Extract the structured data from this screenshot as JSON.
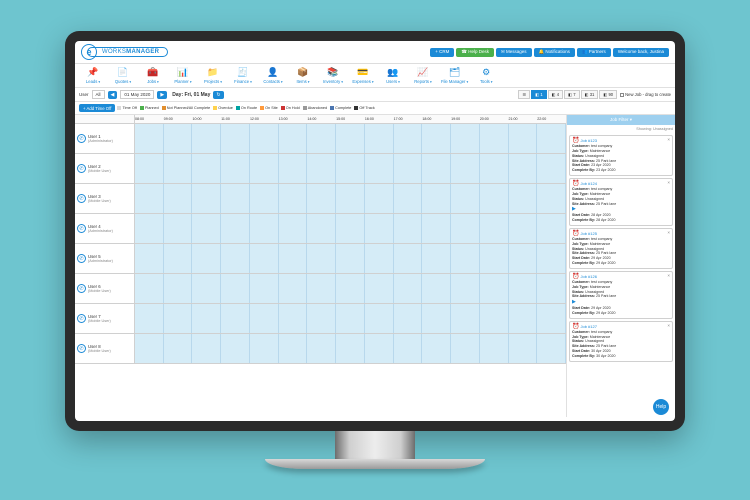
{
  "brand": {
    "icon_letter": "e",
    "name_a": "WORKS",
    "name_b": "MANAGER"
  },
  "top_pills": [
    {
      "label": "+ CRM"
    },
    {
      "label": "☎ Help Desk",
      "alt": true
    },
    {
      "label": "✉ Messages"
    },
    {
      "label": "🔔 Notifications"
    },
    {
      "label": "👥 Partners"
    },
    {
      "label": "Welcome back, Justina"
    }
  ],
  "nav": [
    {
      "icon": "📌",
      "label": "Leads"
    },
    {
      "icon": "📄",
      "label": "Quotes"
    },
    {
      "icon": "🧰",
      "label": "Jobs"
    },
    {
      "icon": "📊",
      "label": "Planner"
    },
    {
      "icon": "📁",
      "label": "Projects"
    },
    {
      "icon": "🧾",
      "label": "Finance"
    },
    {
      "icon": "👤",
      "label": "Contacts"
    },
    {
      "icon": "📦",
      "label": "Items"
    },
    {
      "icon": "📚",
      "label": "Inventory"
    },
    {
      "icon": "💳",
      "label": "Expenses"
    },
    {
      "icon": "👥",
      "label": "Users"
    },
    {
      "icon": "📈",
      "label": "Reports"
    },
    {
      "icon": "🗂",
      "label": "File Manager"
    },
    {
      "icon": "⚙",
      "label": "Tools"
    }
  ],
  "toolbar": {
    "user_label": "User",
    "all_option": "All",
    "prev": "◀",
    "date": "01 May 2020",
    "next": "▶",
    "day_title": "Day: Fri, 01 May",
    "refresh": "↻",
    "views": [
      {
        "label": "☰",
        "active": false
      },
      {
        "label": "◧ 1",
        "active": true
      },
      {
        "label": "◧ 4",
        "active": false
      },
      {
        "label": "◧ 7",
        "active": false
      },
      {
        "label": "◧ 31",
        "active": false
      },
      {
        "label": "◧ 90",
        "active": false
      }
    ],
    "new_job_check": "New Job - drag to create"
  },
  "subbar": {
    "add_time_off": "+ Add Time Off",
    "legend": [
      {
        "color": "#d9d9d9",
        "label": "Time Off"
      },
      {
        "color": "#4bb04b",
        "label": "Planned"
      },
      {
        "color": "#e28f2e",
        "label": "Not Planned/All Complete"
      },
      {
        "color": "#ffd24c",
        "label": "Overdue"
      },
      {
        "color": "#00a3a3",
        "label": "On Route"
      },
      {
        "color": "#ff9a3c",
        "label": "On Site"
      },
      {
        "color": "#cc3333",
        "label": "On Hold"
      },
      {
        "color": "#999999",
        "label": "Abandoned"
      },
      {
        "color": "#4b75b0",
        "label": "Complete"
      },
      {
        "color": "#333333",
        "label": "Off Track"
      }
    ]
  },
  "hours": [
    "08:00",
    "09:00",
    "10:00",
    "11:00",
    "12:00",
    "13:00",
    "14:00",
    "15:00",
    "16:00",
    "17:00",
    "18:00",
    "19:00",
    "20:00",
    "21:00",
    "22:00"
  ],
  "users": [
    {
      "name": "User 1",
      "role": "(Administrator)"
    },
    {
      "name": "User 2",
      "role": "(Mobile User)"
    },
    {
      "name": "User 3",
      "role": "(Mobile User)"
    },
    {
      "name": "User 4",
      "role": "(Administrator)"
    },
    {
      "name": "User 5",
      "role": "(Administrator)"
    },
    {
      "name": "User 6",
      "role": "(Mobile User)"
    },
    {
      "name": "User 7",
      "role": "(Mobile User)"
    },
    {
      "name": "User 8",
      "role": "(Mobile User)"
    }
  ],
  "side": {
    "filter_label": "Job Filter ▾",
    "showing": "Showing: Unassigned",
    "jobs": [
      {
        "ref": "Job #123",
        "customer": "test company",
        "jobtype": "Maintenance",
        "status": "Unassigned",
        "site": "25 Park lane",
        "start": "23 Apr 2020",
        "complete": "23 Apr 2020"
      },
      {
        "ref": "Job #124",
        "customer": "test company",
        "jobtype": "Maintenance",
        "status": "Unassigned",
        "site": "25 Park lane",
        "start": "28 Apr 2020",
        "complete": "28 Apr 2020",
        "play": true
      },
      {
        "ref": "Job #125",
        "customer": "test company",
        "jobtype": "Maintenance",
        "status": "Unassigned",
        "site": "25 Park lane",
        "start": "29 Apr 2020",
        "complete": "29 Apr 2020"
      },
      {
        "ref": "Job #126",
        "customer": "test company",
        "jobtype": "Maintenance",
        "status": "Unassigned",
        "site": "25 Park lane",
        "start": "29 Apr 2020",
        "complete": "29 Apr 2020",
        "play": true
      },
      {
        "ref": "Job #127",
        "customer": "test company",
        "jobtype": "Maintenance",
        "status": "Unassigned",
        "site": "25 Park lane",
        "start": "30 Apr 2020",
        "complete": "30 Apr 2020"
      }
    ],
    "labels": {
      "customer": "Customer:",
      "jobtype": "Job Type:",
      "status": "Status:",
      "site": "Site Address:",
      "start": "Start Date:",
      "complete": "Complete By:"
    }
  },
  "help": "Help"
}
